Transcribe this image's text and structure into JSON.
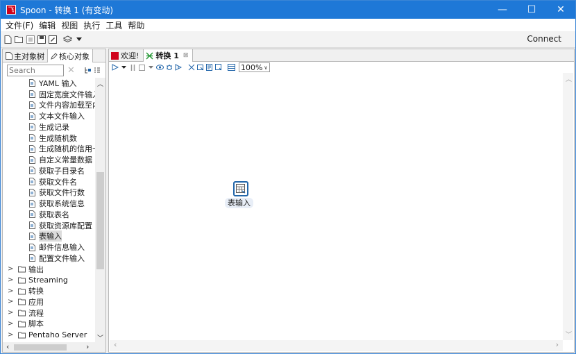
{
  "window": {
    "title": "Spoon - 转换 1 (有变动)",
    "logo_text": "飞",
    "controls": {
      "minimize": "—",
      "maximize": "☐",
      "close": "✕"
    }
  },
  "menubar": [
    "文件(F)",
    "编辑",
    "视图",
    "执行",
    "工具",
    "帮助"
  ],
  "toolbar": {
    "connect_label": "Connect"
  },
  "left_panel": {
    "tabs": [
      "主对象树",
      "核心对象"
    ],
    "search": {
      "placeholder": "Search",
      "value": ""
    },
    "tree": [
      {
        "label": "YAML 输入",
        "type": "child"
      },
      {
        "label": "固定宽度文件输入",
        "type": "child"
      },
      {
        "label": "文件内容加载至内",
        "type": "child"
      },
      {
        "label": "文本文件输入",
        "type": "child"
      },
      {
        "label": "生成记录",
        "type": "child"
      },
      {
        "label": "生成随机数",
        "type": "child"
      },
      {
        "label": "生成随机的信用卡",
        "type": "child"
      },
      {
        "label": "自定义常量数据",
        "type": "child"
      },
      {
        "label": "获取子目录名",
        "type": "child"
      },
      {
        "label": "获取文件名",
        "type": "child"
      },
      {
        "label": "获取文件行数",
        "type": "child"
      },
      {
        "label": "获取系统信息",
        "type": "child"
      },
      {
        "label": "获取表名",
        "type": "child"
      },
      {
        "label": "获取资源库配置",
        "type": "child"
      },
      {
        "label": "表输入",
        "type": "child",
        "selected": true
      },
      {
        "label": "邮件信息输入",
        "type": "child"
      },
      {
        "label": "配置文件输入",
        "type": "child"
      },
      {
        "label": "输出",
        "type": "folder"
      },
      {
        "label": "Streaming",
        "type": "folder"
      },
      {
        "label": "转换",
        "type": "folder"
      },
      {
        "label": "应用",
        "type": "folder"
      },
      {
        "label": "流程",
        "type": "folder"
      },
      {
        "label": "脚本",
        "type": "folder"
      },
      {
        "label": "Pentaho Server",
        "type": "folder"
      }
    ]
  },
  "editor": {
    "tabs": [
      {
        "label": "欢迎!",
        "active": false
      },
      {
        "label": "转换 1",
        "active": true
      }
    ],
    "zoom": "100%",
    "canvas": {
      "steps": [
        {
          "label": "表输入"
        }
      ]
    }
  },
  "colors": {
    "titlebar": "#1e78d7",
    "accent": "#2266aa",
    "selection": "#dcdcdc"
  }
}
